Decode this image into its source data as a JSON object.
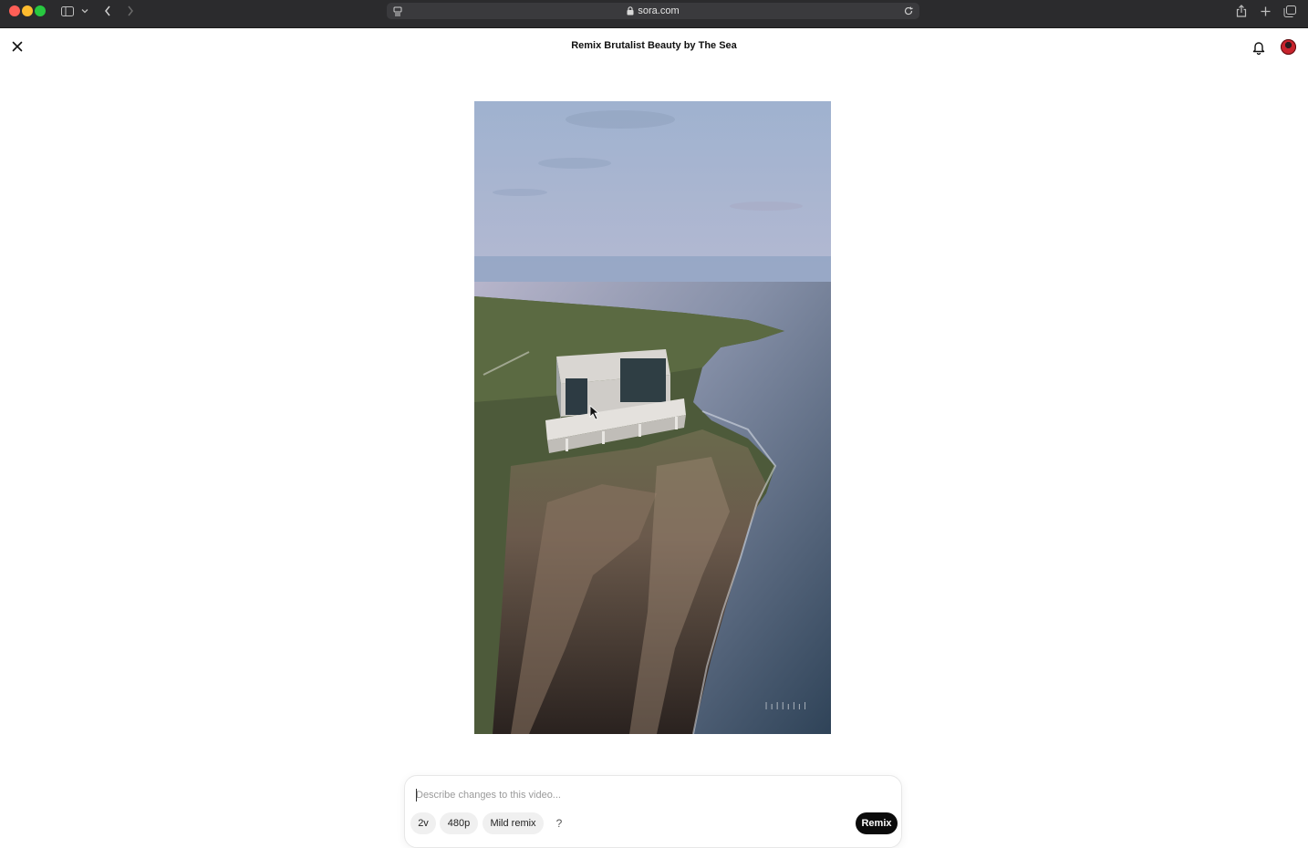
{
  "browser": {
    "url": "sora.com"
  },
  "header": {
    "title": "Remix Brutalist Beauty by The Sea"
  },
  "video": {
    "watermark": "lıllılıl"
  },
  "composer": {
    "placeholder": "Describe changes to this video...",
    "value": "",
    "duration": "2v",
    "resolution": "480p",
    "mode": "Mild remix",
    "help": "?",
    "submit_label": "Remix"
  },
  "icons": {
    "close": "close-icon",
    "bell": "bell-icon",
    "lock": "lock-icon",
    "reload": "reload-icon",
    "share": "share-icon",
    "new_tab": "plus-icon",
    "tabs": "tabs-overview-icon",
    "sidebar": "sidebar-icon",
    "back": "chevron-left-icon",
    "forward": "chevron-right-icon"
  },
  "colors": {
    "remix_button": "#0b0b0b",
    "pill_bg": "#f0f0f0",
    "avatar": "#c8232c"
  }
}
